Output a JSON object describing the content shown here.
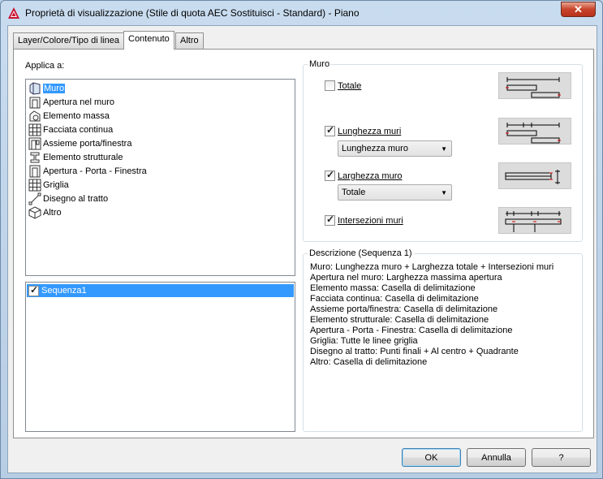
{
  "window": {
    "title": "Proprietà di visualizzazione (Stile di quota AEC Sostituisci - Standard) - Piano",
    "close_label": "✕"
  },
  "tabs": [
    {
      "label": "Layer/Colore/Tipo di linea"
    },
    {
      "label": "Contenuto"
    },
    {
      "label": "Altro"
    }
  ],
  "apply_to": {
    "label": "Applica a:",
    "items": [
      {
        "label": "Muro",
        "icon": "wall-icon"
      },
      {
        "label": "Apertura nel muro",
        "icon": "wall-opening-icon"
      },
      {
        "label": "Elemento massa",
        "icon": "mass-element-icon"
      },
      {
        "label": "Facciata continua",
        "icon": "curtain-wall-icon"
      },
      {
        "label": "Assieme porta/finestra",
        "icon": "door-window-assembly-icon"
      },
      {
        "label": "Elemento strutturale",
        "icon": "structural-member-icon"
      },
      {
        "label": "Apertura - Porta - Finestra",
        "icon": "opening-door-window-icon"
      },
      {
        "label": "Griglia",
        "icon": "grid-icon"
      },
      {
        "label": "Disegno al tratto",
        "icon": "linework-icon"
      },
      {
        "label": "Altro",
        "icon": "other-icon"
      }
    ]
  },
  "sequences": [
    {
      "label": "Sequenza1",
      "checked": true
    }
  ],
  "wall_group": {
    "title": "Muro",
    "total_label": "Totale",
    "wall_length_label": "Lunghezza muri",
    "wall_length_combo": "Lunghezza muro",
    "wall_width_label": "Larghezza muro",
    "wall_width_combo": "Totale",
    "wall_intersections_label": "Intersezioni muri"
  },
  "description": {
    "title": "Descrizione (Sequenza 1)",
    "lines": [
      "Muro: Lunghezza muro + Larghezza totale + Intersezioni muri",
      "Apertura nel muro: Larghezza massima apertura",
      "Elemento massa: Casella di delimitazione",
      "Facciata continua: Casella di delimitazione",
      "Assieme porta/finestra: Casella di delimitazione",
      "Elemento strutturale: Casella di delimitazione",
      "Apertura - Porta - Finestra: Casella di delimitazione",
      "Griglia: Tutte le linee griglia",
      "Disegno al tratto: Punti finali + Al centro + Quadrante",
      "Altro: Casella di delimitazione"
    ]
  },
  "buttons": {
    "ok": "OK",
    "cancel": "Annulla",
    "help": "?"
  }
}
